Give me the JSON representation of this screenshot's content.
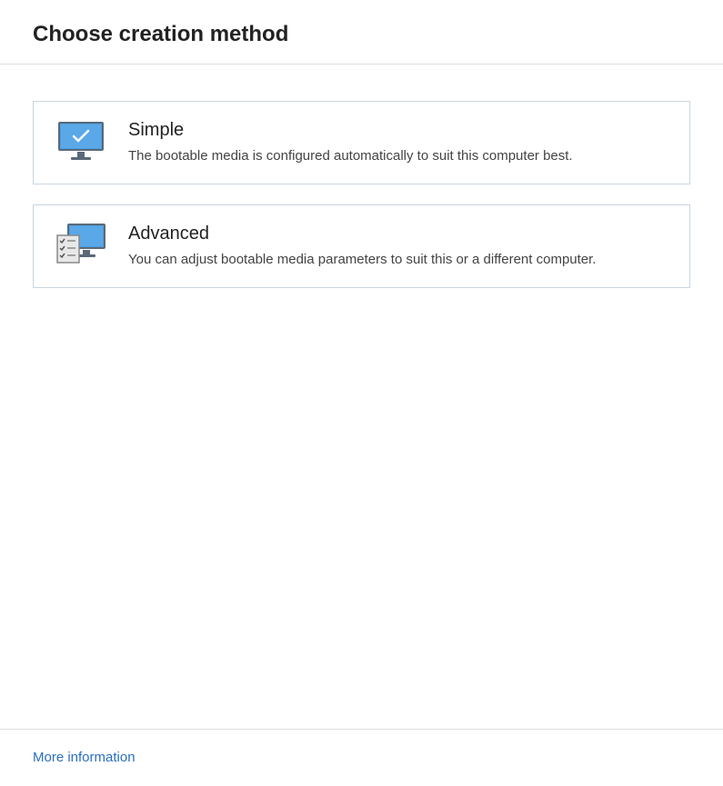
{
  "header": {
    "title": "Choose creation method"
  },
  "options": {
    "simple": {
      "title": "Simple",
      "description": "The bootable media is configured automatically to suit this computer best."
    },
    "advanced": {
      "title": "Advanced",
      "description": "You can adjust bootable media parameters to suit this or a different computer."
    }
  },
  "footer": {
    "more_info": "More information"
  }
}
